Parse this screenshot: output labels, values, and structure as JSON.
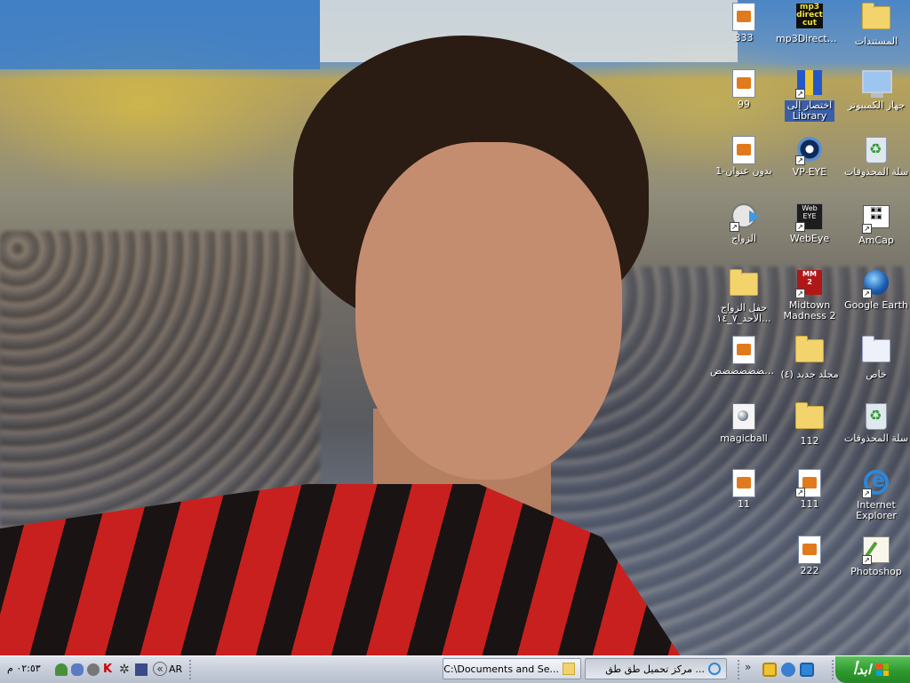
{
  "desktop": {
    "icons": [
      {
        "id": "docs",
        "label": "المستندات",
        "type": "folder",
        "shortcut": false
      },
      {
        "id": "mp3directcut",
        "label": "mp3DirectCut",
        "type": "mp3",
        "shortcut": false
      },
      {
        "id": "f333",
        "label": "333",
        "type": "doc",
        "shortcut": false
      },
      {
        "id": "mycomputer",
        "label": "جهاز الكمبيوتر",
        "type": "pc",
        "shortcut": false
      },
      {
        "id": "library",
        "label": "اختصار إلى Library",
        "type": "books",
        "shortcut": true
      },
      {
        "id": "f99",
        "label": "99",
        "type": "doc",
        "shortcut": false
      },
      {
        "id": "recycle1",
        "label": "سلة المحذوفات",
        "type": "bin",
        "shortcut": false
      },
      {
        "id": "vpeye",
        "label": "VP-EYE",
        "type": "eye",
        "shortcut": true
      },
      {
        "id": "untitled1",
        "label": "بدون عنوان-1",
        "type": "doc",
        "shortcut": false
      },
      {
        "id": "amcap",
        "label": "AmCap",
        "type": "cam",
        "shortcut": true
      },
      {
        "id": "webeye",
        "label": "WebEye",
        "type": "dark",
        "shortcut": true
      },
      {
        "id": "zawaj",
        "label": "الزواج",
        "type": "film",
        "shortcut": true
      },
      {
        "id": "googleearth",
        "label": "Google Earth",
        "type": "globe",
        "shortcut": true
      },
      {
        "id": "midtown",
        "label": "Midtown Madness 2",
        "type": "game",
        "shortcut": true
      },
      {
        "id": "hafl",
        "label": "حفل الزواج الأحد_٧_١٤...",
        "type": "folder",
        "shortcut": false
      },
      {
        "id": "khas",
        "label": "خاص",
        "type": "folderwhite",
        "shortcut": false
      },
      {
        "id": "newfolder4",
        "label": "(مجلد جديد (٤",
        "type": "folder",
        "shortcut": false
      },
      {
        "id": "dhdhdh",
        "label": "ضضضضضضض...",
        "type": "doc",
        "shortcut": false
      },
      {
        "id": "recycle2",
        "label": "سلة المحذوفات",
        "type": "bin",
        "shortcut": false
      },
      {
        "id": "f112",
        "label": "112",
        "type": "folder",
        "shortcut": false
      },
      {
        "id": "magicball",
        "label": "magicball",
        "type": "magic",
        "shortcut": false
      },
      {
        "id": "ie",
        "label": "Internet Explorer",
        "type": "ie",
        "shortcut": true
      },
      {
        "id": "f111",
        "label": "111",
        "type": "doc",
        "shortcut": true
      },
      {
        "id": "f11",
        "label": "11",
        "type": "doc",
        "shortcut": false
      },
      {
        "id": "photoshop",
        "label": "Photoshop",
        "type": "ps",
        "shortcut": true
      },
      {
        "id": "f222",
        "label": "222",
        "type": "doc",
        "shortcut": false
      }
    ]
  },
  "taskbar": {
    "start_label": "ابدأ",
    "tasks": [
      {
        "label": "مركز تحميل طق طق ...",
        "icon": "ie-icon",
        "active": false
      },
      {
        "label": "C:\\Documents and Se...",
        "icon": "folder-icon",
        "active": false
      }
    ],
    "language": "AR",
    "clock": "٠٢:٥٣ م",
    "overflow_chevron": "«",
    "quick_launch_chevron": "»"
  },
  "colors": {
    "taskbar": "#c9cfdb",
    "start_green": "#2e9a2e",
    "icon_label_selected": "#3a5fa8"
  }
}
